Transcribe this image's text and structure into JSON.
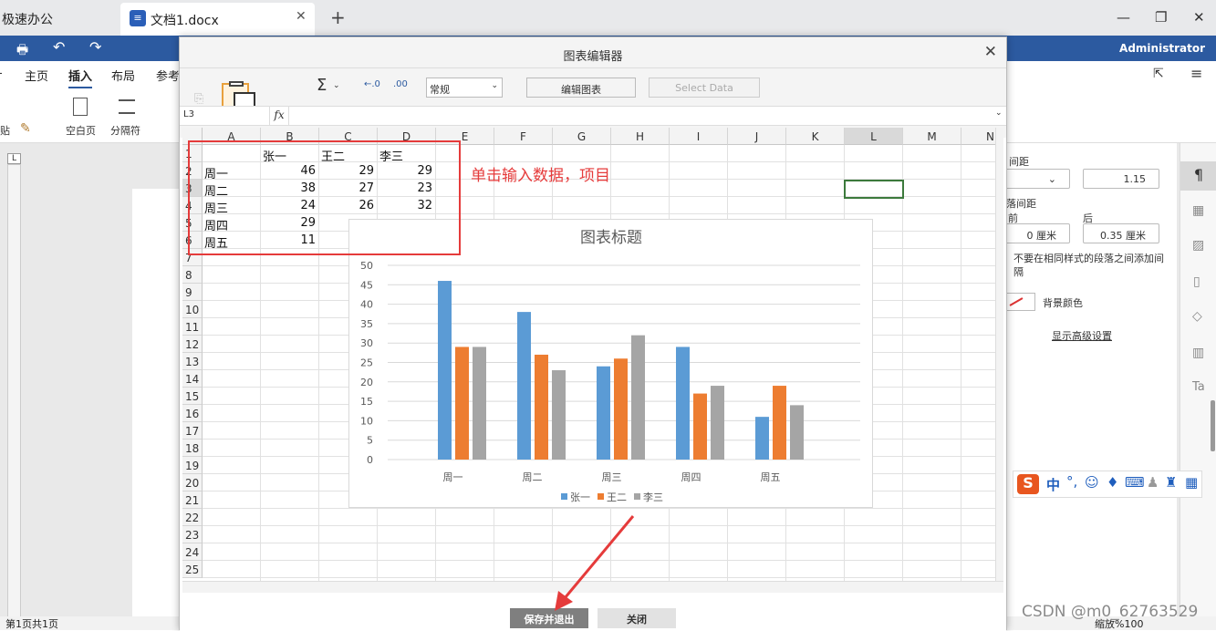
{
  "app": {
    "name": "极速办公",
    "doc_tab": "文档1.docx",
    "user": "Administrator"
  },
  "menu": [
    "主页",
    "插入",
    "布局",
    "参考"
  ],
  "ribbon": {
    "blank_page": "空白页",
    "separator": "分隔符",
    "paste_frag": "贴"
  },
  "dialog": {
    "title": "图表编辑器",
    "cell_ref": "L3",
    "fx": "fx",
    "number_format": "常规",
    "edit_chart": "编辑图表",
    "select_data": "Select Data",
    "save_exit": "保存并退出",
    "close": "关闭"
  },
  "sheet": {
    "columns": [
      "A",
      "B",
      "C",
      "D",
      "E",
      "F",
      "G",
      "H",
      "I",
      "J",
      "K",
      "L",
      "M",
      "N"
    ],
    "rows": [
      "1",
      "2",
      "3",
      "4",
      "5",
      "6",
      "7",
      "8",
      "9",
      "10",
      "11",
      "12",
      "13",
      "14",
      "15",
      "16",
      "17",
      "18",
      "19",
      "20",
      "21",
      "22",
      "23",
      "24",
      "25"
    ],
    "table": {
      "header": [
        "",
        "张一",
        "王二",
        "李三"
      ],
      "data": [
        [
          "周一",
          "46",
          "29",
          "29"
        ],
        [
          "周二",
          "38",
          "27",
          "23"
        ],
        [
          "周三",
          "24",
          "26",
          "32"
        ],
        [
          "周四",
          "29",
          "",
          ""
        ],
        [
          "周五",
          "11",
          "",
          ""
        ]
      ]
    }
  },
  "annotation": "单击输入数据，项目",
  "chart_data": {
    "type": "bar",
    "title": "图表标题",
    "categories": [
      "周一",
      "周二",
      "周三",
      "周四",
      "周五"
    ],
    "series": [
      {
        "name": "张一",
        "values": [
          46,
          38,
          24,
          29,
          11
        ],
        "color": "#5b9bd5"
      },
      {
        "name": "王二",
        "values": [
          29,
          27,
          26,
          17,
          19
        ],
        "color": "#ed7d31"
      },
      {
        "name": "李三",
        "values": [
          29,
          23,
          32,
          19,
          14
        ],
        "color": "#a5a5a5"
      }
    ],
    "ylim": [
      0,
      50
    ],
    "yticks": [
      "0",
      "5",
      "10",
      "15",
      "20",
      "25",
      "30",
      "35",
      "40",
      "45",
      "50"
    ],
    "grid": true,
    "legend": "bottom"
  },
  "right_panel": {
    "line_spacing_label": "间距",
    "line_spacing_value": "1.15",
    "para_spacing_label": "落间距",
    "before_label": "前",
    "after_label": "后",
    "before_value": "0 厘米",
    "after_value": "0.35 厘米",
    "no_space_text": "不要在相同样式的段落之间添加间",
    "no_space_text2": "隔",
    "bg_color": "背景颜色",
    "advanced": "显示高级设置"
  },
  "status": {
    "page": "第1页共1页",
    "zoom": "缩放%100"
  },
  "watermark": "CSDN @m0_62763529"
}
